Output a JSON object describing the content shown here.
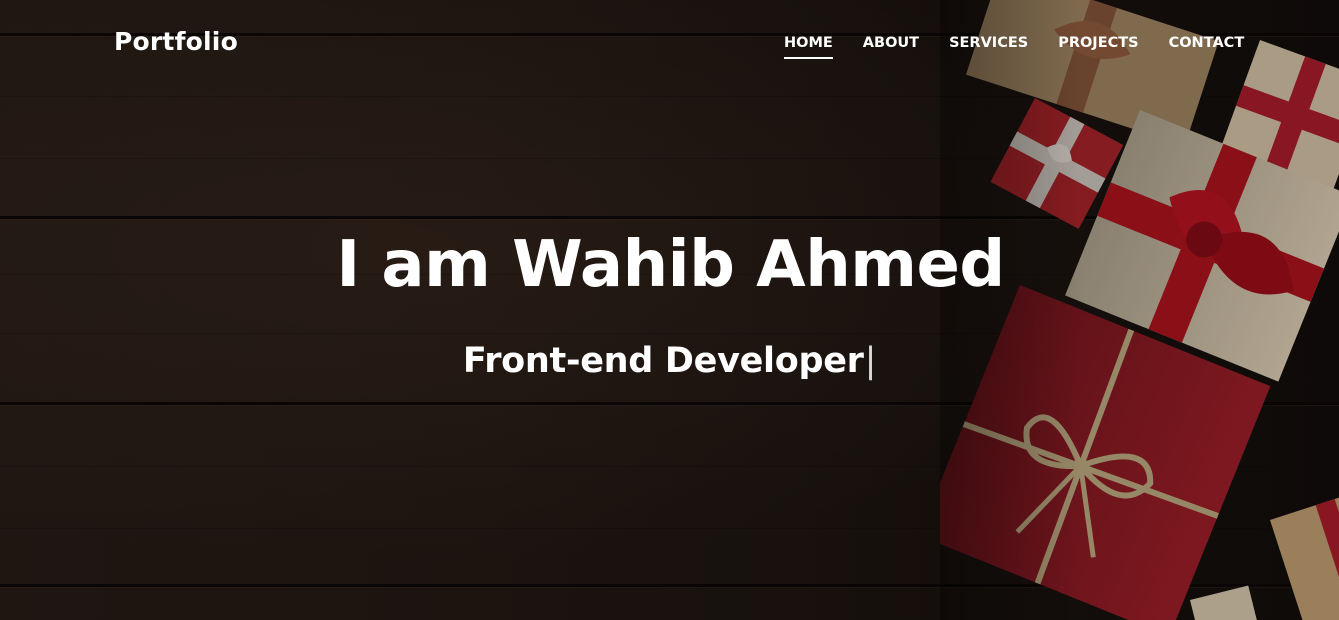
{
  "navbar": {
    "brand": "Portfolio",
    "links": [
      {
        "label": "HOME",
        "active": true
      },
      {
        "label": "ABOUT",
        "active": false
      },
      {
        "label": "SERVICES",
        "active": false
      },
      {
        "label": "PROJECTS",
        "active": false
      },
      {
        "label": "CONTACT",
        "active": false
      }
    ]
  },
  "hero": {
    "headline": "I am Wahib Ahmed",
    "typed_text": "Front-end Developer",
    "cursor": "|",
    "background": "dark wooden planks with wrapped gift boxes",
    "colors": {
      "wood": "#2a1e18",
      "gift_red": "#b0202c",
      "gift_cream": "#e9d9bd",
      "twine": "#c9b48a"
    }
  }
}
